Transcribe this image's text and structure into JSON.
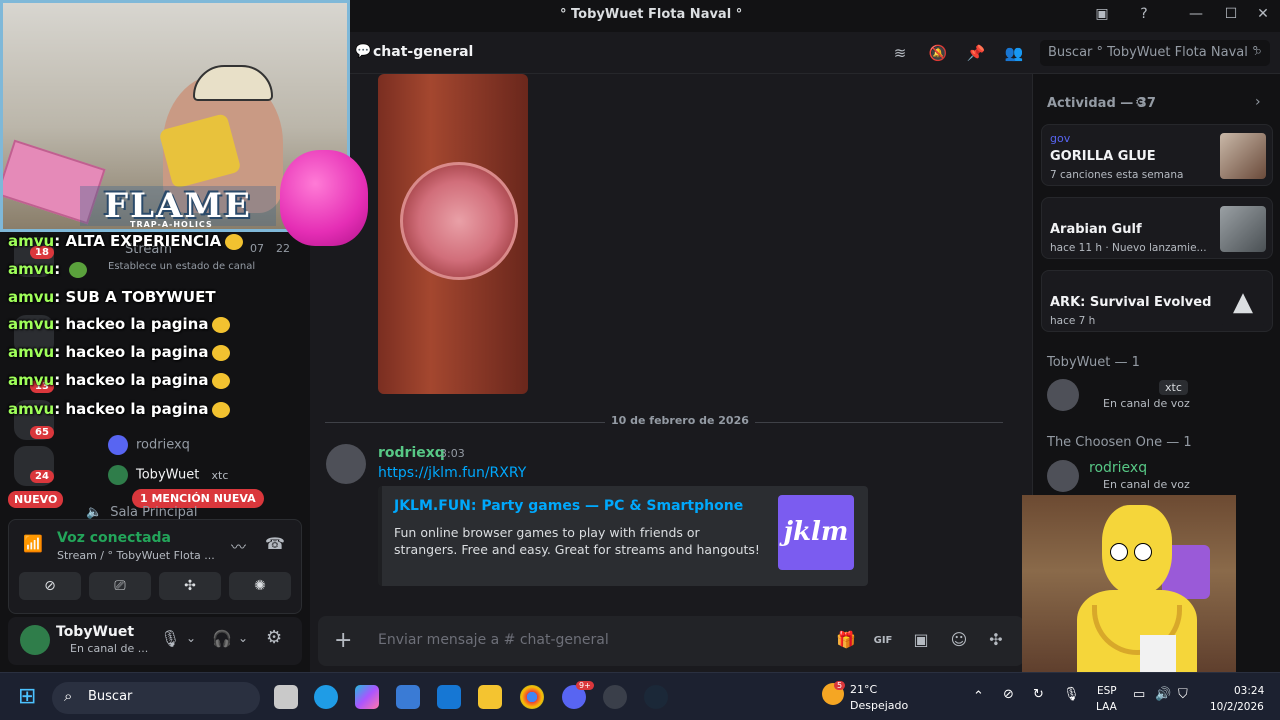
{
  "window": {
    "title": "° TobyWuet Flota Naval °"
  },
  "stream_overlay": {
    "brand": "FLAME",
    "brand_sub": "TRAP-A-HOLICS",
    "chat_lines": [
      {
        "name": "amvu",
        "text": "ALTA EXPERIENCIA"
      },
      {
        "name": "amvu",
        "text": ""
      },
      {
        "name": "amvu",
        "text": "SUB A TOBYWUET"
      },
      {
        "name": "amvu",
        "text": "hackeo la pagina"
      },
      {
        "name": "amvu",
        "text": "hackeo la pagina"
      },
      {
        "name": "amvu",
        "text": "hackeo la pagina"
      },
      {
        "name": "amvu",
        "text": "hackeo la pagina"
      }
    ]
  },
  "sidebar": {
    "server_badges": [
      "18",
      "13",
      "65",
      "24"
    ],
    "new_label": "NUEVO",
    "mention_pill": "1 MENCIÓN NUEVA",
    "stream_label": "Stream",
    "status_hint": "Establece un estado de canal",
    "members": [
      {
        "name": "rodriexq",
        "tag": ""
      },
      {
        "name": "TobyWuet",
        "tag": "xtc"
      }
    ],
    "voice_channel": "Sala Principal",
    "counters": [
      "07",
      "22"
    ]
  },
  "voice_panel": {
    "title": "Voz conectada",
    "subtitle": "Stream / ° TobyWuet Flota ..."
  },
  "user_panel": {
    "name": "TobyWuet",
    "status": "En canal de ..."
  },
  "chat": {
    "channel_name": "chat-general",
    "search_placeholder": "Buscar ° TobyWuet Flota Naval °",
    "date_divider": "10 de febrero de 2026",
    "message": {
      "author": "rodriexq",
      "time": "3:03",
      "link": "https://jklm.fun/RXRY",
      "embed": {
        "title": "JKLM.FUN: Party games — PC & Smartphone",
        "description": "Fun online browser games to play with friends or strangers. Free and easy. Great for streams and hangouts!",
        "logo_text": "jklm"
      }
    },
    "composer_placeholder": "Enviar mensaje a # chat-general"
  },
  "activity": {
    "header": "Actividad — 37",
    "cards": [
      {
        "user": "gov",
        "title": "GORILLA GLUE",
        "sub": "7 canciones esta semana"
      },
      {
        "user": "",
        "title": "Arabian Gulf",
        "sub": "hace 11 h  ·  Nuevo lanzamie..."
      },
      {
        "user": "",
        "title": "ARK: Survival Evolved",
        "sub": "hace 7 h"
      }
    ]
  },
  "members_panel": {
    "group1": "TobyWuet — 1",
    "group1_tag": "xtc",
    "group1_status": "En canal de voz",
    "group2": "The Choosen One — 1",
    "group2_member": "rodriexq",
    "group2_status": "En canal de voz"
  },
  "taskbar": {
    "search_label": "Buscar",
    "weather_temp": "21°C",
    "weather_desc": "Despejado",
    "weather_badge": "5",
    "lang_top": "ESP",
    "lang_bottom": "LAA",
    "time": "03:24",
    "date": "10/2/2026",
    "discord_badge": "9+"
  },
  "colors": {
    "accent_link": "#00a8fc",
    "username_green": "#57c785",
    "danger": "#da373c",
    "background": "#1a1a1e"
  }
}
